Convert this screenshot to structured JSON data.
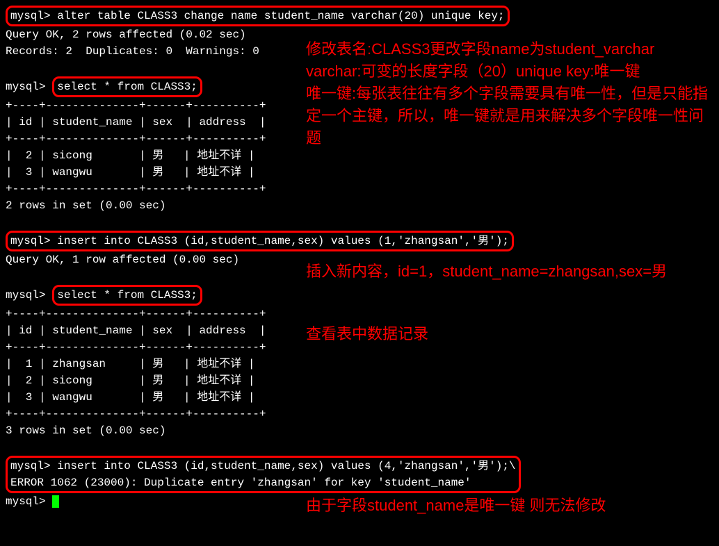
{
  "terminal": {
    "prompt": "mysql>",
    "cmd1": "alter table CLASS3 change name student_name varchar(20) unique key;",
    "result1_line1": "Query OK, 2 rows affected (0.02 sec)",
    "result1_line2": "Records: 2  Duplicates: 0  Warnings: 0",
    "cmd2": "select * from CLASS3;",
    "table1": {
      "border": "+----+--------------+------+----------+",
      "header": "| id | student_name | sex  | address  |",
      "row1": "|  2 | sicong       | ",
      "row1b": "   | ",
      "row1c": " |",
      "row2": "|  3 | wangwu       | ",
      "row2b": "   | ",
      "row2c": " |",
      "sex_val": "男",
      "addr_val": "地址不详"
    },
    "result2": "2 rows in set (0.00 sec)",
    "cmd3": "insert into CLASS3 (id,student_name,sex) values (1,'zhangsan','男');",
    "result3": "Query OK, 1 row affected (0.00 sec)",
    "cmd4": "select * from CLASS3;",
    "table2": {
      "border": "+----+--------------+------+----------+",
      "header": "| id | student_name | sex  | address  |",
      "row1": "|  1 | zhangsan     | ",
      "row2": "|  2 | sicong       | ",
      "row3": "|  3 | wangwu       | ",
      "rowb": "   | ",
      "rowc": " |",
      "sex_val": "男",
      "addr_val": "地址不详"
    },
    "result4": "3 rows in set (0.00 sec)",
    "cmd5": "insert into CLASS3 (id,student_name,sex) values (4,'zhangsan','男');\\",
    "error": "ERROR 1062 (23000): Duplicate entry 'zhangsan' for key 'student_name'"
  },
  "annotations": {
    "a1": "修改表名:CLASS3更改字段name为student_varchar varchar:可变的长度字段（20）unique key:唯一键\n唯一键:每张表往往有多个字段需要具有唯一性，但是只能指定一个主键，所以，唯一键就是用来解决多个字段唯一性问题",
    "a2": "插入新内容，id=1，student_name=zhangsan,sex=男",
    "a3": "查看表中数据记录",
    "a4": "由于字段student_name是唯一键 则无法修改"
  }
}
